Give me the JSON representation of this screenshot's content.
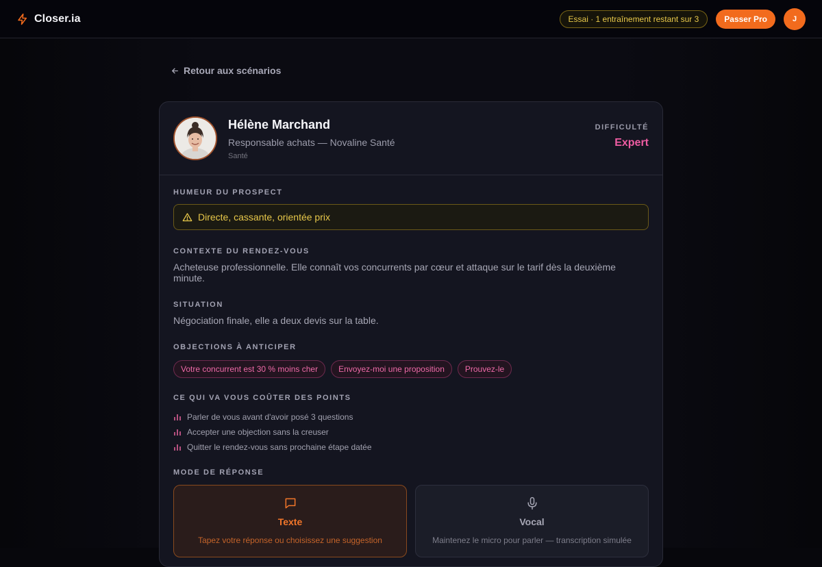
{
  "app": {
    "name": "Closer.ia"
  },
  "header": {
    "trial_badge": "Essai · 1 entraînement restant sur 3",
    "pro_button": "Passer Pro",
    "avatar_initial": "J"
  },
  "back_link": "Retour aux scénarios",
  "prospect": {
    "name": "Hélène Marchand",
    "role": "Responsable achats — Novaline Santé",
    "sector": "Santé",
    "difficulty_label": "DIFFICULTÉ",
    "difficulty_value": "Expert"
  },
  "sections": {
    "mood_label": "HUMEUR DU PROSPECT",
    "mood_value": "Directe, cassante, orientée prix",
    "context_label": "CONTEXTE DU RENDEZ-VOUS",
    "context_text": "Acheteuse professionnelle. Elle connaît vos concurrents par cœur et attaque sur le tarif dès la deuxième minute.",
    "situation_label": "SITUATION",
    "situation_text": "Négociation finale, elle a deux devis sur la table.",
    "objections_label": "OBJECTIONS À ANTICIPER",
    "objections": [
      "Votre concurrent est 30 % moins cher",
      "Envoyez-moi une proposition",
      "Prouvez-le"
    ],
    "penalties_label": "CE QUI VA VOUS COÛTER DES POINTS",
    "penalties": [
      "Parler de vous avant d'avoir posé 3 questions",
      "Accepter une objection sans la creuser",
      "Quitter le rendez-vous sans prochaine étape datée"
    ],
    "mode_label": "MODE DE RÉPONSE",
    "modes": [
      {
        "title": "Texte",
        "desc": "Tapez votre réponse ou choisissez une suggestion",
        "icon": "chat-icon",
        "selected": true
      },
      {
        "title": "Vocal",
        "desc": "Maintenez le micro pour parler — transcription simulée",
        "icon": "microphone-icon",
        "selected": false
      }
    ]
  },
  "colors": {
    "accent": "#f26b1d",
    "warning": "#e8c84a",
    "danger_pink": "#ee5ca2",
    "background": "#0b0b12",
    "card": "#141520"
  }
}
